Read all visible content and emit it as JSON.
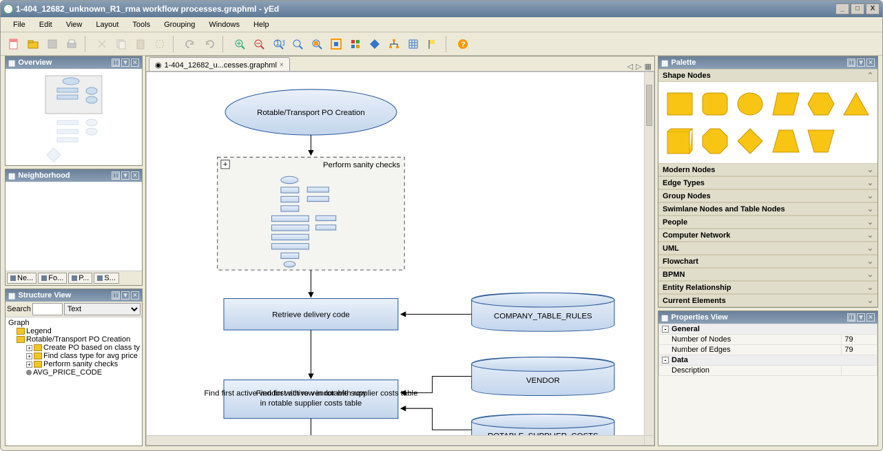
{
  "title": "1-404_12682_unknown_R1_rma workflow processes.graphml - yEd",
  "menubar": [
    "File",
    "Edit",
    "View",
    "Layout",
    "Tools",
    "Grouping",
    "Windows",
    "Help"
  ],
  "tab": {
    "label": "1-404_12682_u...cesses.graphml"
  },
  "panels": {
    "overview": "Overview",
    "neighborhood": "Neighborhood",
    "structure": "Structure View",
    "palette": "Palette",
    "properties": "Properties View"
  },
  "minitabs": [
    "Ne...",
    "Fo...",
    "P...",
    "S..."
  ],
  "structure": {
    "search_label": "Search",
    "mode": "Text",
    "root": "Graph",
    "items": [
      {
        "label": "Legend",
        "indent": 1,
        "type": "folder"
      },
      {
        "label": "Rotable/Transport PO Creation",
        "indent": 1,
        "type": "folder"
      },
      {
        "label": "Create PO based on class ty",
        "indent": 2,
        "type": "folder",
        "expand": "+"
      },
      {
        "label": "Find class type for avg price",
        "indent": 2,
        "type": "folder",
        "expand": "+"
      },
      {
        "label": "Perform sanity checks",
        "indent": 2,
        "type": "folder",
        "expand": "+"
      },
      {
        "label": "AVG_PRICE_CODE",
        "indent": 2,
        "type": "node"
      }
    ]
  },
  "palette_sections": [
    "Shape Nodes",
    "Modern Nodes",
    "Edge Types",
    "Group Nodes",
    "Swimlane Nodes and Table Nodes",
    "People",
    "Computer Network",
    "UML",
    "Flowchart",
    "BPMN",
    "Entity Relationship",
    "Current Elements"
  ],
  "properties": {
    "groups": [
      {
        "name": "General",
        "rows": [
          {
            "k": "Number of Nodes",
            "v": "79"
          },
          {
            "k": "Number of Edges",
            "v": "79"
          }
        ]
      },
      {
        "name": "Data",
        "rows": [
          {
            "k": "Description",
            "v": ""
          }
        ]
      }
    ]
  },
  "diagram": {
    "start": "Rotable/Transport PO Creation",
    "group": "Perform sanity checks",
    "proc1": "Retrieve delivery code",
    "proc2": "Find first active vendor with row in rotable supplier costs table",
    "db1": "COMPANY_TABLE_RULES",
    "db2": "VENDOR",
    "db3": "ROTABLE_SUPPLIER_COSTS"
  },
  "chart_data": {
    "type": "flowchart",
    "nodes": [
      {
        "id": "n1",
        "type": "start-ellipse",
        "label": "Rotable/Transport PO Creation"
      },
      {
        "id": "g1",
        "type": "group-collapsed",
        "label": "Perform sanity checks"
      },
      {
        "id": "p1",
        "type": "process",
        "label": "Retrieve delivery code"
      },
      {
        "id": "p2",
        "type": "process",
        "label": "Find first active vendor with row in rotable supplier costs table"
      },
      {
        "id": "d1",
        "type": "database",
        "label": "COMPANY_TABLE_RULES"
      },
      {
        "id": "d2",
        "type": "database",
        "label": "VENDOR"
      },
      {
        "id": "d3",
        "type": "database",
        "label": "ROTABLE_SUPPLIER_COSTS"
      }
    ],
    "edges": [
      {
        "from": "n1",
        "to": "g1"
      },
      {
        "from": "g1",
        "to": "p1"
      },
      {
        "from": "d1",
        "to": "p1"
      },
      {
        "from": "p1",
        "to": "p2"
      },
      {
        "from": "d2",
        "to": "p2"
      },
      {
        "from": "d3",
        "to": "p2"
      }
    ]
  }
}
